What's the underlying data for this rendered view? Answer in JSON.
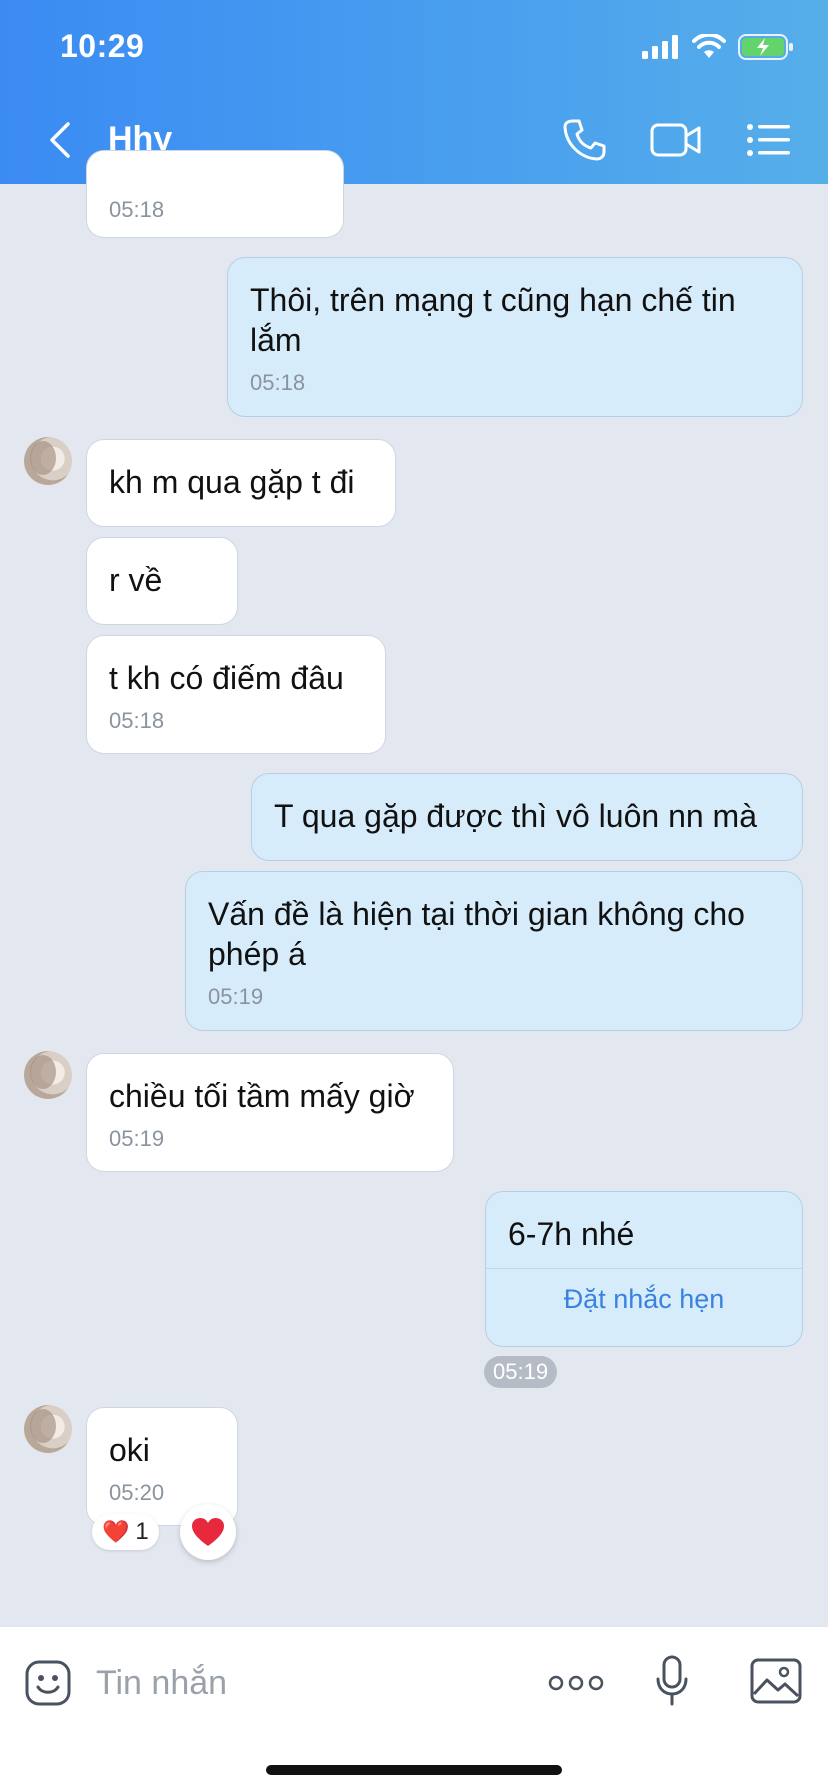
{
  "status_bar": {
    "time": "10:29"
  },
  "header": {
    "title": "Hhy"
  },
  "messages": [
    {
      "from": "them",
      "text": "",
      "time": "05:18"
    },
    {
      "from": "me",
      "text": "Thôi, trên mạng t cũng hạn chế tin lắm",
      "time": "05:18"
    },
    {
      "from": "them",
      "text": "kh m qua gặp t đi",
      "time": ""
    },
    {
      "from": "them",
      "text": "r về",
      "time": ""
    },
    {
      "from": "them",
      "text": "t kh có điếm đâu",
      "time": "05:18"
    },
    {
      "from": "me",
      "text": "T qua gặp được thì vô luôn nn mà",
      "time": ""
    },
    {
      "from": "me",
      "text": "Vấn đề là hiện tại thời gian không cho phép á",
      "time": "05:19"
    },
    {
      "from": "them",
      "text": "chiều tối tầm mấy giờ",
      "time": "05:19"
    },
    {
      "from": "me",
      "text": "6-7h nhé",
      "time": "05:19",
      "action": "Đặt nhắc hẹn"
    },
    {
      "from": "them",
      "text": "oki",
      "time": "05:20",
      "reaction": {
        "emoji": "❤️",
        "count": "1"
      }
    }
  ],
  "input": {
    "placeholder": "Tin nhắn"
  },
  "icons": {
    "back": "chevron-left-icon",
    "call": "phone-icon",
    "video": "video-camera-icon",
    "menu": "list-menu-icon",
    "sticker": "sticker-icon",
    "more": "more-dots-icon",
    "mic": "microphone-icon",
    "image": "image-icon"
  },
  "colors": {
    "accent": "#3b8bf3",
    "my_bubble": "#d6ecfb",
    "their_bubble": "#ffffff",
    "link": "#3b82e0"
  }
}
